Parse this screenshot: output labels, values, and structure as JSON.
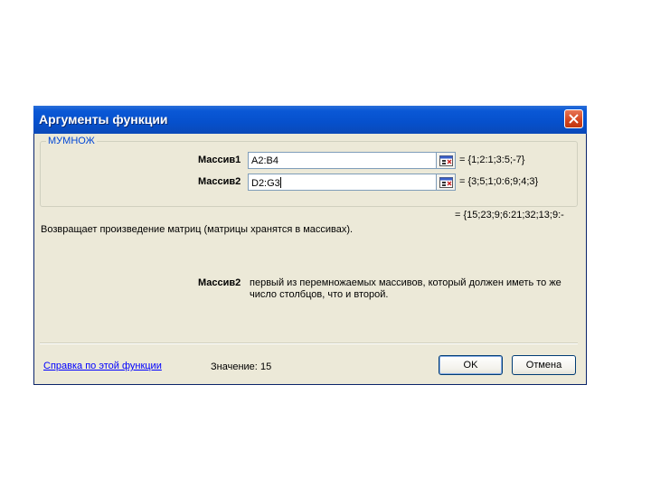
{
  "window": {
    "title": "Аргументы функции"
  },
  "function": {
    "name": "МУМНОЖ"
  },
  "arguments": [
    {
      "label": "Массив1",
      "value": "A2:B4",
      "evaluated": "= {1;2:1;3:5;-7}"
    },
    {
      "label": "Массив2",
      "value": "D2:G3",
      "evaluated": "= {3;5;1;0:6;9;4;3}"
    }
  ],
  "result_preview": "= {15;23;9;6:21;32;13;9:-",
  "description": "Возвращает произведение матриц (матрицы хранятся в массивах).",
  "argument_help": {
    "label": "Массив2",
    "line1": "первый из перемножаемых массивов, который должен иметь то же",
    "line2": "число столбцов, что и второй."
  },
  "footer": {
    "help_link": "Справка по этой функции",
    "value_label": "Значение:",
    "value": "15",
    "ok_label": "OK",
    "cancel_label": "Отмена"
  },
  "colors": {
    "titlebar": "#0650cc",
    "dialog_background": "#ece9d8",
    "group_title": "#0046d5",
    "link": "#0000ff",
    "close_button": "#d3441e"
  },
  "icons": {
    "close": "close-icon",
    "collapse": "range-select-icon"
  }
}
